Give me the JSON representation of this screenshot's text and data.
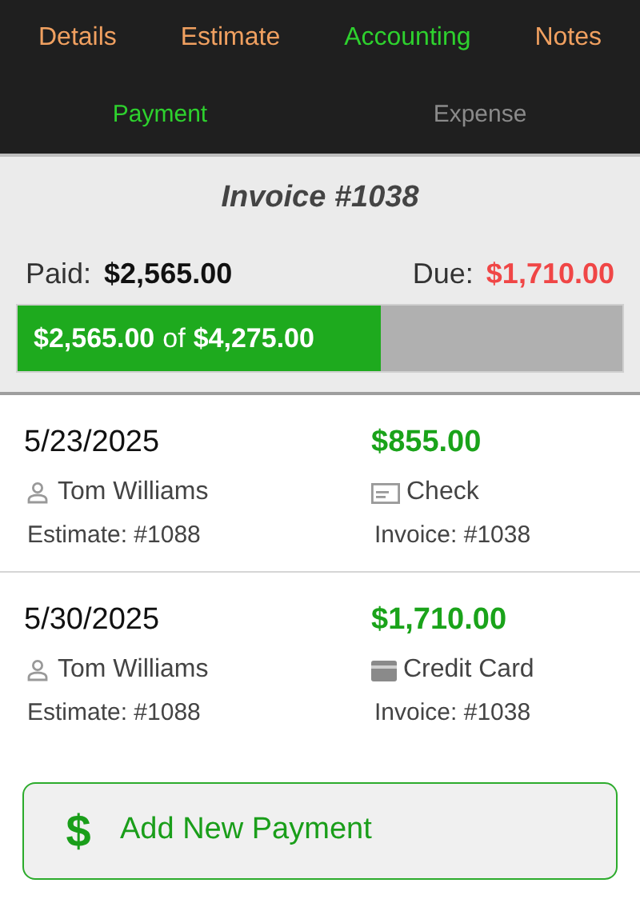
{
  "tabs": [
    {
      "label": "Details",
      "selected": false
    },
    {
      "label": "Estimate",
      "selected": false
    },
    {
      "label": "Accounting",
      "selected": true
    },
    {
      "label": "Notes",
      "selected": false
    }
  ],
  "subtabs": [
    {
      "label": "Payment",
      "selected": true
    },
    {
      "label": "Expense",
      "selected": false
    }
  ],
  "invoice": {
    "title": "Invoice #1038",
    "paid_label": "Paid:",
    "paid": "$2,565.00",
    "due_label": "Due:",
    "due": "$1,710.00",
    "progress": {
      "level": 0.6,
      "paid": "$2,565.00",
      "of": "of",
      "total": "$4,275.00"
    }
  },
  "payments": [
    {
      "date": "5/23/2025",
      "amount": "$855.00",
      "person": "Tom Williams",
      "method": "Check",
      "kind": "check",
      "estimate": "Estimate: #1088",
      "invoice": "Invoice: #1038"
    },
    {
      "date": "5/30/2025",
      "amount": "$1,710.00",
      "person": "Tom Williams",
      "method": "Credit Card",
      "kind": "card",
      "estimate": "Estimate: #1088",
      "invoice": "Invoice: #1038"
    }
  ],
  "add_button": {
    "icon": "$",
    "label": "Add New Payment"
  }
}
